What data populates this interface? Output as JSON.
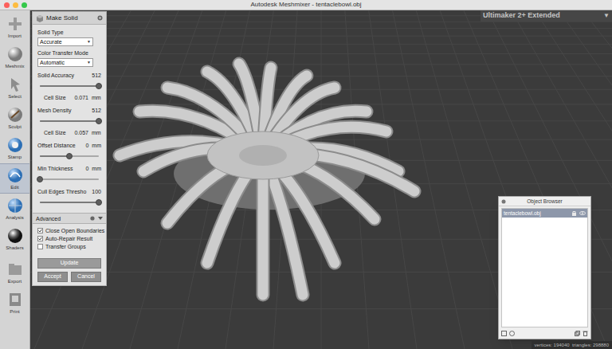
{
  "window": {
    "title": "Autodesk Meshmixer - tentaclebowl.obj"
  },
  "toolbar": {
    "items": [
      {
        "label": "Import",
        "selected": false
      },
      {
        "label": "Meshmix",
        "selected": false
      },
      {
        "label": "Select",
        "selected": false
      },
      {
        "label": "Sculpt",
        "selected": false
      },
      {
        "label": "Stamp",
        "selected": false
      },
      {
        "label": "Edit",
        "selected": true
      },
      {
        "label": "Analysis",
        "selected": false
      },
      {
        "label": "Shaders",
        "selected": false
      },
      {
        "label": "Export",
        "selected": false
      },
      {
        "label": "Print",
        "selected": false
      }
    ]
  },
  "panel": {
    "title": "Make Solid",
    "fields": [
      {
        "kind": "select",
        "label": "Solid Type",
        "value": "Accurate",
        "arrow": "▼"
      },
      {
        "kind": "select",
        "label": "Color Transfer Mode",
        "value": "Automatic",
        "arrow": "▼"
      },
      {
        "kind": "slider",
        "label": "Solid Accuracy",
        "value": "512",
        "level": 1
      },
      {
        "kind": "reading",
        "label": "Cell Size",
        "value": "0.071",
        "unit": "mm"
      },
      {
        "kind": "slider",
        "label": "Mesh Density",
        "value": "512",
        "level": 1
      },
      {
        "kind": "reading",
        "label": "Cell Size",
        "value": "0.057",
        "unit": "mm"
      },
      {
        "kind": "slider",
        "label": "Offset Distance",
        "value": "0",
        "unit": "mm",
        "level": 0.5
      },
      {
        "kind": "slider",
        "label": "Min Thickness",
        "value": "0",
        "unit": "mm",
        "level": 0
      },
      {
        "kind": "slider",
        "label": "Cull Edges Thresho",
        "value": "100",
        "level": 1
      }
    ],
    "advanced": {
      "title": "Advanced",
      "options": [
        {
          "label": "Close Open Boundaries",
          "checked": true
        },
        {
          "label": "Auto-Repair Result",
          "checked": true
        },
        {
          "label": "Transfer Groups",
          "checked": false
        }
      ]
    },
    "buttons": [
      "Update",
      "Accept",
      "Cancel"
    ]
  },
  "printer": {
    "label": "Ultimaker 2+ Extended",
    "arrow": "▼"
  },
  "object_browser": {
    "title": "Object Browser",
    "items": [
      {
        "label": "tentaclebowl.obj",
        "selected": true
      }
    ]
  },
  "status_bar": "vertices: 194040  triangles: 298880"
}
